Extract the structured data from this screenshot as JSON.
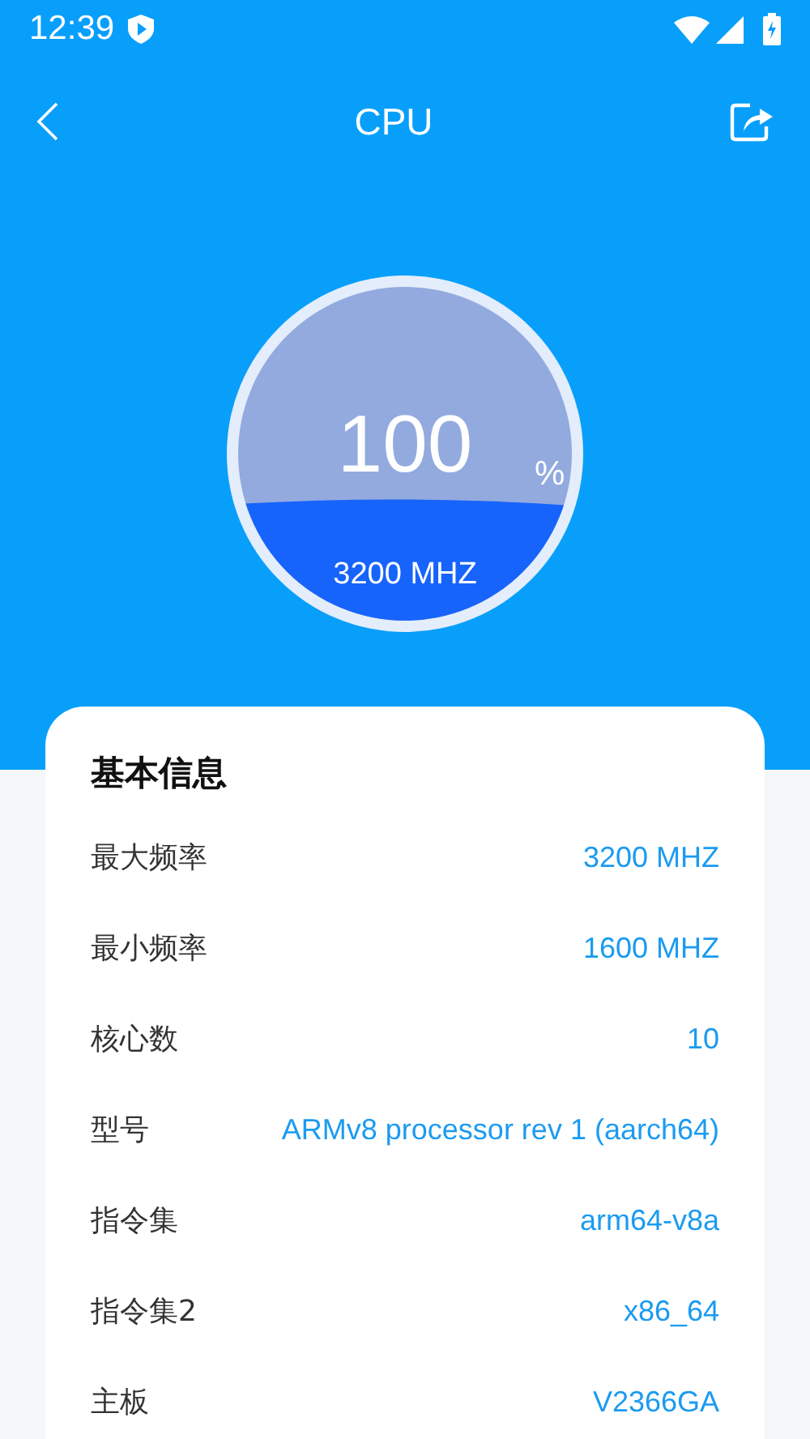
{
  "status_bar": {
    "time": "12:39"
  },
  "header": {
    "title": "CPU"
  },
  "gauge": {
    "value": "100",
    "unit": "%",
    "frequency": "3200 MHZ"
  },
  "info_card": {
    "title": "基本信息",
    "rows": [
      {
        "label": "最大频率",
        "value": "3200 MHZ"
      },
      {
        "label": "最小频率",
        "value": "1600 MHZ"
      },
      {
        "label": "核心数",
        "value": "10"
      },
      {
        "label": "型号",
        "value": "ARMv8 processor rev 1 (aarch64)"
      },
      {
        "label": "指令集",
        "value": "arm64-v8a"
      },
      {
        "label": "指令集2",
        "value": "x86_64"
      },
      {
        "label": "主板",
        "value": "V2366GA"
      }
    ]
  }
}
